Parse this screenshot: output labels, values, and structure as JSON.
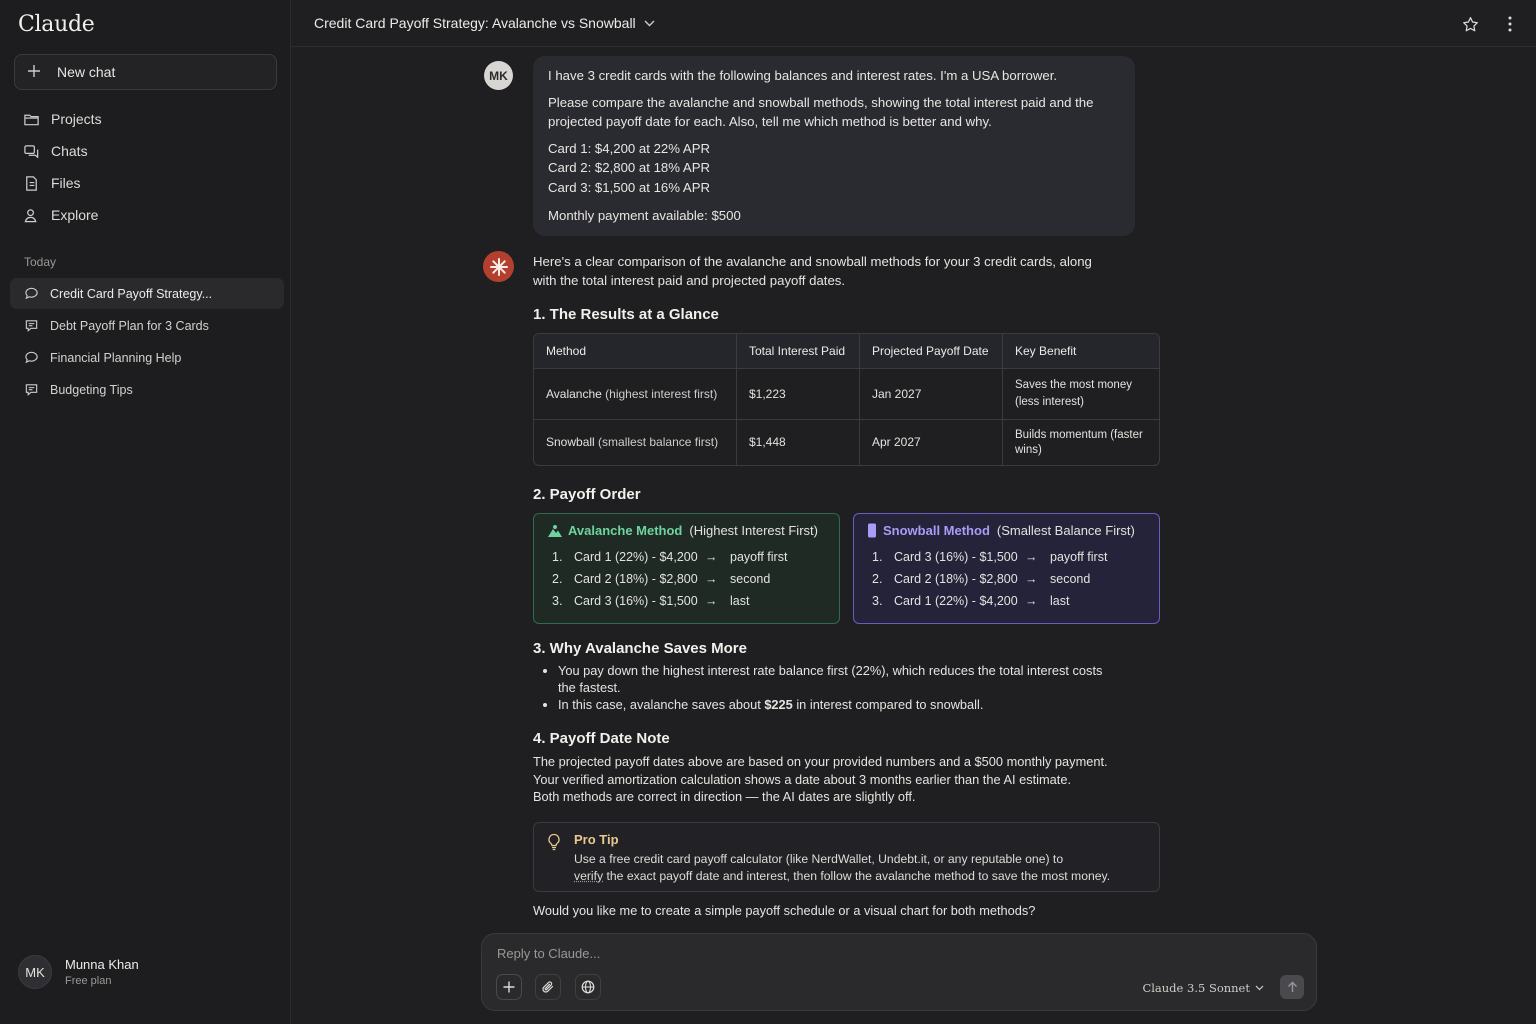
{
  "app": {
    "logo": "Claude"
  },
  "sidebar": {
    "new_chat": "New chat",
    "nav": [
      {
        "label": "Projects",
        "icon": "folder-icon"
      },
      {
        "label": "Chats",
        "icon": "chats-icon"
      },
      {
        "label": "Files",
        "icon": "file-icon"
      },
      {
        "label": "Explore",
        "icon": "explore-icon"
      }
    ],
    "section_today": "Today",
    "recents": [
      "Credit Card Payoff Strategy...",
      "Debt Payoff Plan for 3 Cards",
      "Financial Planning Help",
      "Budgeting Tips"
    ],
    "user": {
      "initials": "MK",
      "name": "Munna Khan",
      "plan": "Free plan"
    }
  },
  "header": {
    "title": "Credit Card Payoff Strategy: Avalanche vs Snowball"
  },
  "user_message": {
    "avatar": "MK",
    "line1": "I have 3 credit cards with the following balances and interest rates. I'm a USA borrower.",
    "line2": "Please compare the avalanche and snowball methods, showing the total interest paid and the projected payoff date for each. Also, tell me which method is better and why.",
    "cards": [
      "Card 1: $4,200 at 22% APR",
      "Card 2: $2,800 at 18% APR",
      "Card 3: $1,500 at 16% APR"
    ],
    "payment": "Monthly payment available: $500"
  },
  "assistant": {
    "intro": "Here's a clear comparison of the avalanche and snowball methods for your 3 credit cards, along with the total interest paid and projected payoff dates.",
    "s1_title": "1. The Results at a Glance",
    "table": {
      "headers": [
        "Method",
        "Total Interest Paid",
        "Projected Payoff Date",
        "Key Benefit"
      ],
      "rows": [
        {
          "method": "Avalanche",
          "method_note": "(highest interest first)",
          "interest": "$1,223",
          "date": "Jan 2027",
          "benefit": "Saves the most money (less interest)"
        },
        {
          "method": "Snowball",
          "method_note": "(smallest balance first)",
          "interest": "$1,448",
          "date": "Apr 2027",
          "benefit": "Builds momentum (faster wins)"
        }
      ]
    },
    "s2_title": "2. Payoff Order",
    "avalanche": {
      "name": "Avalanche Method",
      "sub": "(Highest Interest First)",
      "rows": [
        {
          "n": "1.",
          "card": "Card 1 (22%) - $4,200",
          "step": "payoff first"
        },
        {
          "n": "2.",
          "card": "Card 2 (18%) - $2,800",
          "step": "second"
        },
        {
          "n": "3.",
          "card": "Card 3 (16%) - $1,500",
          "step": "last"
        }
      ]
    },
    "snowball": {
      "name": "Snowball Method",
      "sub": "(Smallest Balance First)",
      "rows": [
        {
          "n": "1.",
          "card": "Card 3 (16%) - $1,500",
          "step": "payoff first"
        },
        {
          "n": "2.",
          "card": "Card 2 (18%) - $2,800",
          "step": "second"
        },
        {
          "n": "3.",
          "card": "Card 1 (22%) - $4,200",
          "step": "last"
        }
      ]
    },
    "arrow": "→",
    "s3_title": "3. Why Avalanche Saves More",
    "b1": "You pay down the highest interest rate balance first (22%), which reduces the total interest costs the fastest.",
    "b2_pre": "In this case, avalanche saves about ",
    "b2_bold": "$225",
    "b2_post": " in interest compared to snowball.",
    "s4_title": "4. Payoff Date Note",
    "note1": "The projected payoff dates above are based on your provided numbers and a  $500 monthly payment.",
    "note2": "Your verified amortization calculation shows a date about 3 months earlier than the AI estimate.",
    "note3": "Both methods are correct in direction — the AI dates are slightly off.",
    "tip_title": "Pro Tip",
    "tip_line1": "Use a free credit card payoff calculator (like NerdWallet, Undebt.it, or any reputable one) to",
    "tip_verify": "verify",
    "tip_line2": " the exact payoff date and interest, then follow the avalanche method to save the most money.",
    "question": "Would you like me to create a simple payoff schedule or a visual chart for both methods?"
  },
  "composer": {
    "placeholder": "Reply to Claude...",
    "model": "Claude 3.5 Sonnet"
  },
  "colors": {
    "accent": "#b3402f",
    "avalanche": "#6fd3a0",
    "snowball": "#a99cf6",
    "tip": "#e9c98f"
  }
}
